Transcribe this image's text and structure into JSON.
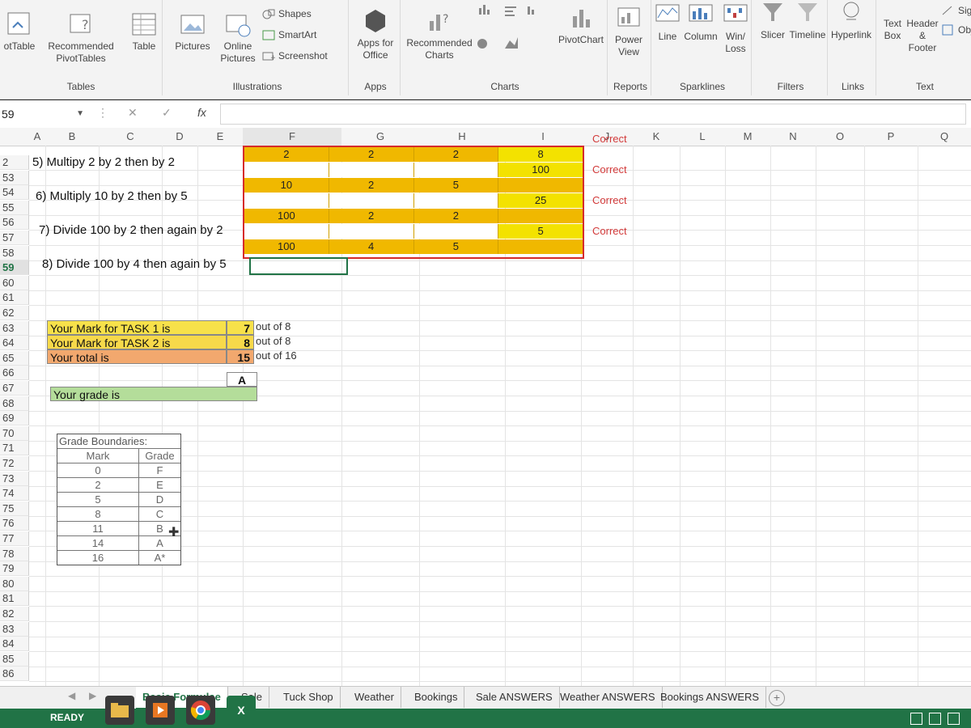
{
  "ribbon": {
    "groups": {
      "tables": {
        "label": "Tables",
        "buttons": {
          "pivot": "otTable",
          "recommended_line1": "Recommended",
          "recommended_line2": "PivotTables",
          "table": "Table"
        }
      },
      "illustrations": {
        "label": "Illustrations",
        "buttons": {
          "pictures": "Pictures",
          "online_line1": "Online",
          "online_line2": "Pictures",
          "shapes": "Shapes",
          "smartart": "SmartArt",
          "screenshot": "Screenshot"
        }
      },
      "apps": {
        "label": "Apps",
        "buttons": {
          "apps_line1": "Apps for",
          "apps_line2": "Office"
        }
      },
      "charts": {
        "label": "Charts",
        "buttons": {
          "recommended_line1": "Recommended",
          "recommended_line2": "Charts",
          "pivotchart": "PivotChart"
        }
      },
      "reports": {
        "label": "Reports",
        "buttons": {
          "power_line1": "Power",
          "power_line2": "View"
        }
      },
      "sparklines": {
        "label": "Sparklines",
        "buttons": {
          "line": "Line",
          "column": "Column",
          "winloss_line1": "Win/",
          "winloss_line2": "Loss"
        }
      },
      "filters": {
        "label": "Filters",
        "buttons": {
          "slicer": "Slicer",
          "timeline": "Timeline"
        }
      },
      "links": {
        "label": "Links",
        "buttons": {
          "hyperlink": "Hyperlink"
        }
      },
      "text": {
        "label": "Text",
        "buttons": {
          "textbox_line1": "Text",
          "textbox_line2": "Box",
          "header_line1": "Header",
          "header_line2": "& Footer",
          "sign": "Sign",
          "object": "Obje"
        }
      }
    }
  },
  "formula_bar": {
    "name_box": "59",
    "fx": "fx",
    "cancel": "✕",
    "confirm": "✓",
    "value": ""
  },
  "columns": [
    "A",
    "B",
    "C",
    "D",
    "E",
    "F",
    "G",
    "H",
    "I",
    "J",
    "K",
    "L",
    "M",
    "N",
    "O",
    "P",
    "Q"
  ],
  "rows": [
    "2",
    "53",
    "54",
    "55",
    "56",
    "57",
    "58",
    "59",
    "60",
    "61",
    "62",
    "63",
    "64",
    "65",
    "66",
    "67",
    "68",
    "69",
    "70",
    "71",
    "72",
    "73",
    "74",
    "75",
    "76",
    "77",
    "78",
    "79",
    "80",
    "81",
    "82",
    "83",
    "84",
    "85",
    "86"
  ],
  "selected_row": "59",
  "questions": [
    "5) Multipy 2 by 2 then by 2",
    "6) Multiply 10 by 2 then by 5",
    "7) Divide 100 by 2 then again by 2",
    "8) Divide 100 by 4 then again by 5"
  ],
  "answers": [
    {
      "row": [
        "2",
        "2",
        "2",
        "8"
      ],
      "highlight_last": true
    },
    {
      "row": [
        "",
        "",
        "",
        "100"
      ],
      "highlight_last": true
    },
    {
      "row": [
        "10",
        "2",
        "5",
        ""
      ],
      "highlight_last": false
    },
    {
      "row": [
        "",
        "",
        "",
        "25"
      ],
      "highlight_last": true
    },
    {
      "row": [
        "100",
        "2",
        "2",
        ""
      ],
      "highlight_last": false
    },
    {
      "row": [
        "",
        "",
        "",
        "5"
      ],
      "highlight_last": true
    },
    {
      "row": [
        "100",
        "4",
        "5",
        ""
      ],
      "highlight_last": false
    }
  ],
  "feedback": [
    "Correct",
    "Correct",
    "Correct",
    "Correct"
  ],
  "marks": {
    "task1": {
      "label": "Your Mark for TASK 1 is",
      "value": "7",
      "out_of": "out of 8",
      "color": "#f7e14a"
    },
    "task2": {
      "label": "Your Mark for TASK 2 is",
      "value": "8",
      "out_of": "out of 8",
      "color": "#f7d94a"
    },
    "total": {
      "label": "Your total is",
      "value": "15",
      "out_of": "out of 16",
      "color": "#f2a86e"
    },
    "grade": {
      "label": "Your grade is",
      "value": "A",
      "color": "#b4dd9a"
    }
  },
  "grade_boundaries": {
    "title": "Grade Boundaries:",
    "headers": {
      "mark": "Mark",
      "grade": "Grade"
    },
    "rows": [
      {
        "mark": "0",
        "grade": "F"
      },
      {
        "mark": "2",
        "grade": "E"
      },
      {
        "mark": "5",
        "grade": "D"
      },
      {
        "mark": "8",
        "grade": "C"
      },
      {
        "mark": "11",
        "grade": "B"
      },
      {
        "mark": "14",
        "grade": "A"
      },
      {
        "mark": "16",
        "grade": "A*"
      }
    ]
  },
  "sheet_tabs": [
    "Basic Formulae",
    "Sale",
    "Tuck Shop",
    "Weather",
    "Bookings",
    "Sale ANSWERS",
    "Weather ANSWERS",
    "Bookings ANSWERS"
  ],
  "active_tab": "Basic Formulae",
  "status": {
    "ready": "READY"
  },
  "taskbar": {
    "excel": "X"
  },
  "colors": {
    "excel_green": "#217346",
    "answer_orange": "#f0b800",
    "answer_border": "#d62b2b",
    "correct_red": "#d23a3a"
  }
}
